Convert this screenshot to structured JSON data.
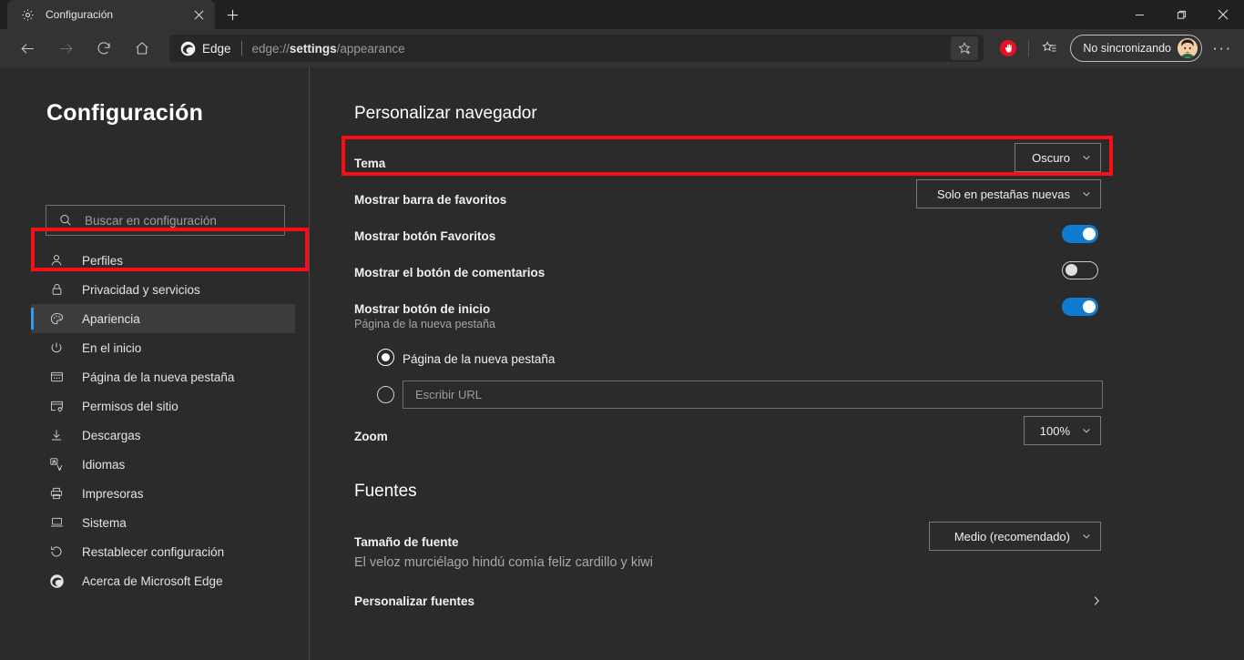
{
  "window": {
    "tab_title": "Configuración",
    "tab_favicon": "gear-icon",
    "close_tab_glyph": "✕",
    "new_tab_glyph": "+",
    "minimize_glyph": "—",
    "maximize_glyph": "❐",
    "close_glyph": "✕"
  },
  "toolbar": {
    "back_glyph": "←",
    "forward_glyph": "→",
    "reload_glyph": "⟳",
    "home_glyph": "⌂",
    "brand_chip": "Edge",
    "url_prefix": "edge://",
    "url_bold": "settings",
    "url_suffix": "/appearance",
    "favorite_icon": "star-add-icon",
    "extension_icon": "red-stop-hand-icon",
    "collections_icon": "collections-icon",
    "sync_label": "No sincronizando",
    "profile_icon": "avatar",
    "more_glyph": "···"
  },
  "sidebar": {
    "title": "Configuración",
    "search": {
      "placeholder": "Buscar en configuración",
      "icon": "search-icon"
    },
    "items": [
      {
        "label": "Perfiles",
        "icon": "person-icon",
        "active": false
      },
      {
        "label": "Privacidad y servicios",
        "icon": "lock-icon",
        "active": false
      },
      {
        "label": "Apariencia",
        "icon": "palette-icon",
        "active": true
      },
      {
        "label": "En el inicio",
        "icon": "power-icon",
        "active": false
      },
      {
        "label": "Página de la nueva pestaña",
        "icon": "newtab-page-icon",
        "active": false
      },
      {
        "label": "Permisos del sitio",
        "icon": "site-permissions-icon",
        "active": false
      },
      {
        "label": "Descargas",
        "icon": "download-arrow-icon",
        "active": false
      },
      {
        "label": "Idiomas",
        "icon": "languages-icon",
        "active": false
      },
      {
        "label": "Impresoras",
        "icon": "printer-icon",
        "active": false
      },
      {
        "label": "Sistema",
        "icon": "laptop-icon",
        "active": false
      },
      {
        "label": "Restablecer configuración",
        "icon": "reset-circular-arrow-icon",
        "active": false
      },
      {
        "label": "Acerca de Microsoft Edge",
        "icon": "edge-logo-icon",
        "active": false
      }
    ]
  },
  "main": {
    "customize_section": {
      "heading": "Personalizar navegador",
      "theme": {
        "label": "Tema",
        "value": "Oscuro"
      },
      "favorites_bar": {
        "label": "Mostrar barra de favoritos",
        "value": "Solo en pestañas nuevas"
      },
      "favorites_button": {
        "label": "Mostrar botón Favoritos",
        "state": "on"
      },
      "feedback_button": {
        "label": "Mostrar el botón de comentarios",
        "state": "off"
      },
      "home_button": {
        "label": "Mostrar botón de inicio",
        "sublabel": "Página de la nueva pestaña",
        "state": "on",
        "option_newtab": "Página de la nueva pestaña",
        "option_newtab_selected": true,
        "option_url_placeholder": "Escribir URL",
        "option_url_selected": false
      },
      "zoom": {
        "label": "Zoom",
        "value": "100%"
      }
    },
    "fonts_section": {
      "heading": "Fuentes",
      "font_size": {
        "label": "Tamaño de fuente",
        "value": "Medio (recomendado)"
      },
      "sample_text": "El veloz murciélago hindú comía feliz cardillo y kiwi",
      "customize_fonts": {
        "label": "Personalizar fuentes",
        "arrow": "›"
      }
    }
  },
  "annotations": {
    "highlight_color": "#fb0d13",
    "boxes": [
      {
        "name": "theme-row-highlight"
      },
      {
        "name": "sidebar-apariencia-highlight"
      }
    ]
  }
}
